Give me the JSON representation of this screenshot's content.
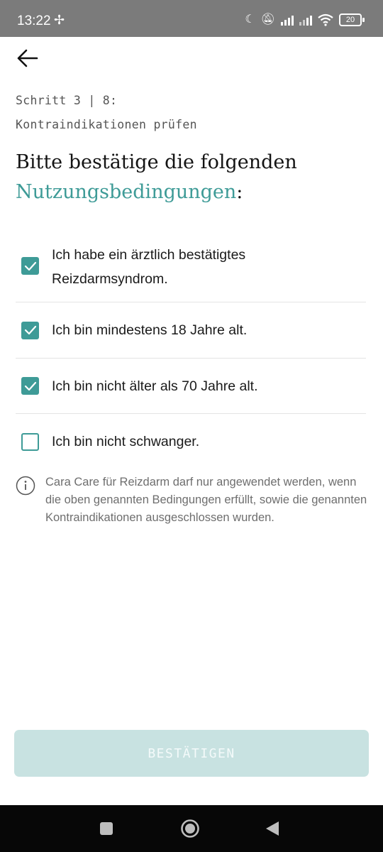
{
  "status_bar": {
    "time": "13:22",
    "battery": "20",
    "icons": [
      "fan-icon",
      "moon-icon",
      "mute-icon",
      "signal-icon",
      "signal-icon",
      "wifi-icon",
      "battery-icon"
    ]
  },
  "header": {
    "back_icon": "arrow-left-icon",
    "step": "Schritt 3 | 8:",
    "step_title": "Kontraindikationen prüfen"
  },
  "headline": {
    "line1": "Bitte bestätige die folgenden",
    "accent": "Nutzungsbedingungen",
    "suffix": ":"
  },
  "checklist": [
    {
      "label": "Ich habe ein ärztlich bestätigtes Reizdarmsyndrom.",
      "checked": true
    },
    {
      "label": "Ich bin mindestens 18 Jahre alt.",
      "checked": true
    },
    {
      "label": "Ich bin nicht älter als 70 Jahre alt.",
      "checked": true
    },
    {
      "label": "Ich bin nicht schwanger.",
      "checked": false
    }
  ],
  "info": {
    "icon": "info-icon",
    "text": "Cara Care für Reizdarm darf nur angewendet werden, wenn die oben genannten Bedingungen erfüllt, sowie die genannten Kontraindikationen ausgeschlossen wurden."
  },
  "confirm_button": {
    "label": "BESTÄTIGEN",
    "enabled": false
  },
  "colors": {
    "accent": "#3e9b97",
    "button_disabled": "#c8e2e1",
    "status_bar": "#7b7b7b"
  },
  "nav_bar": {
    "buttons": [
      "square-icon",
      "home-circle-icon",
      "back-triangle-icon"
    ]
  }
}
